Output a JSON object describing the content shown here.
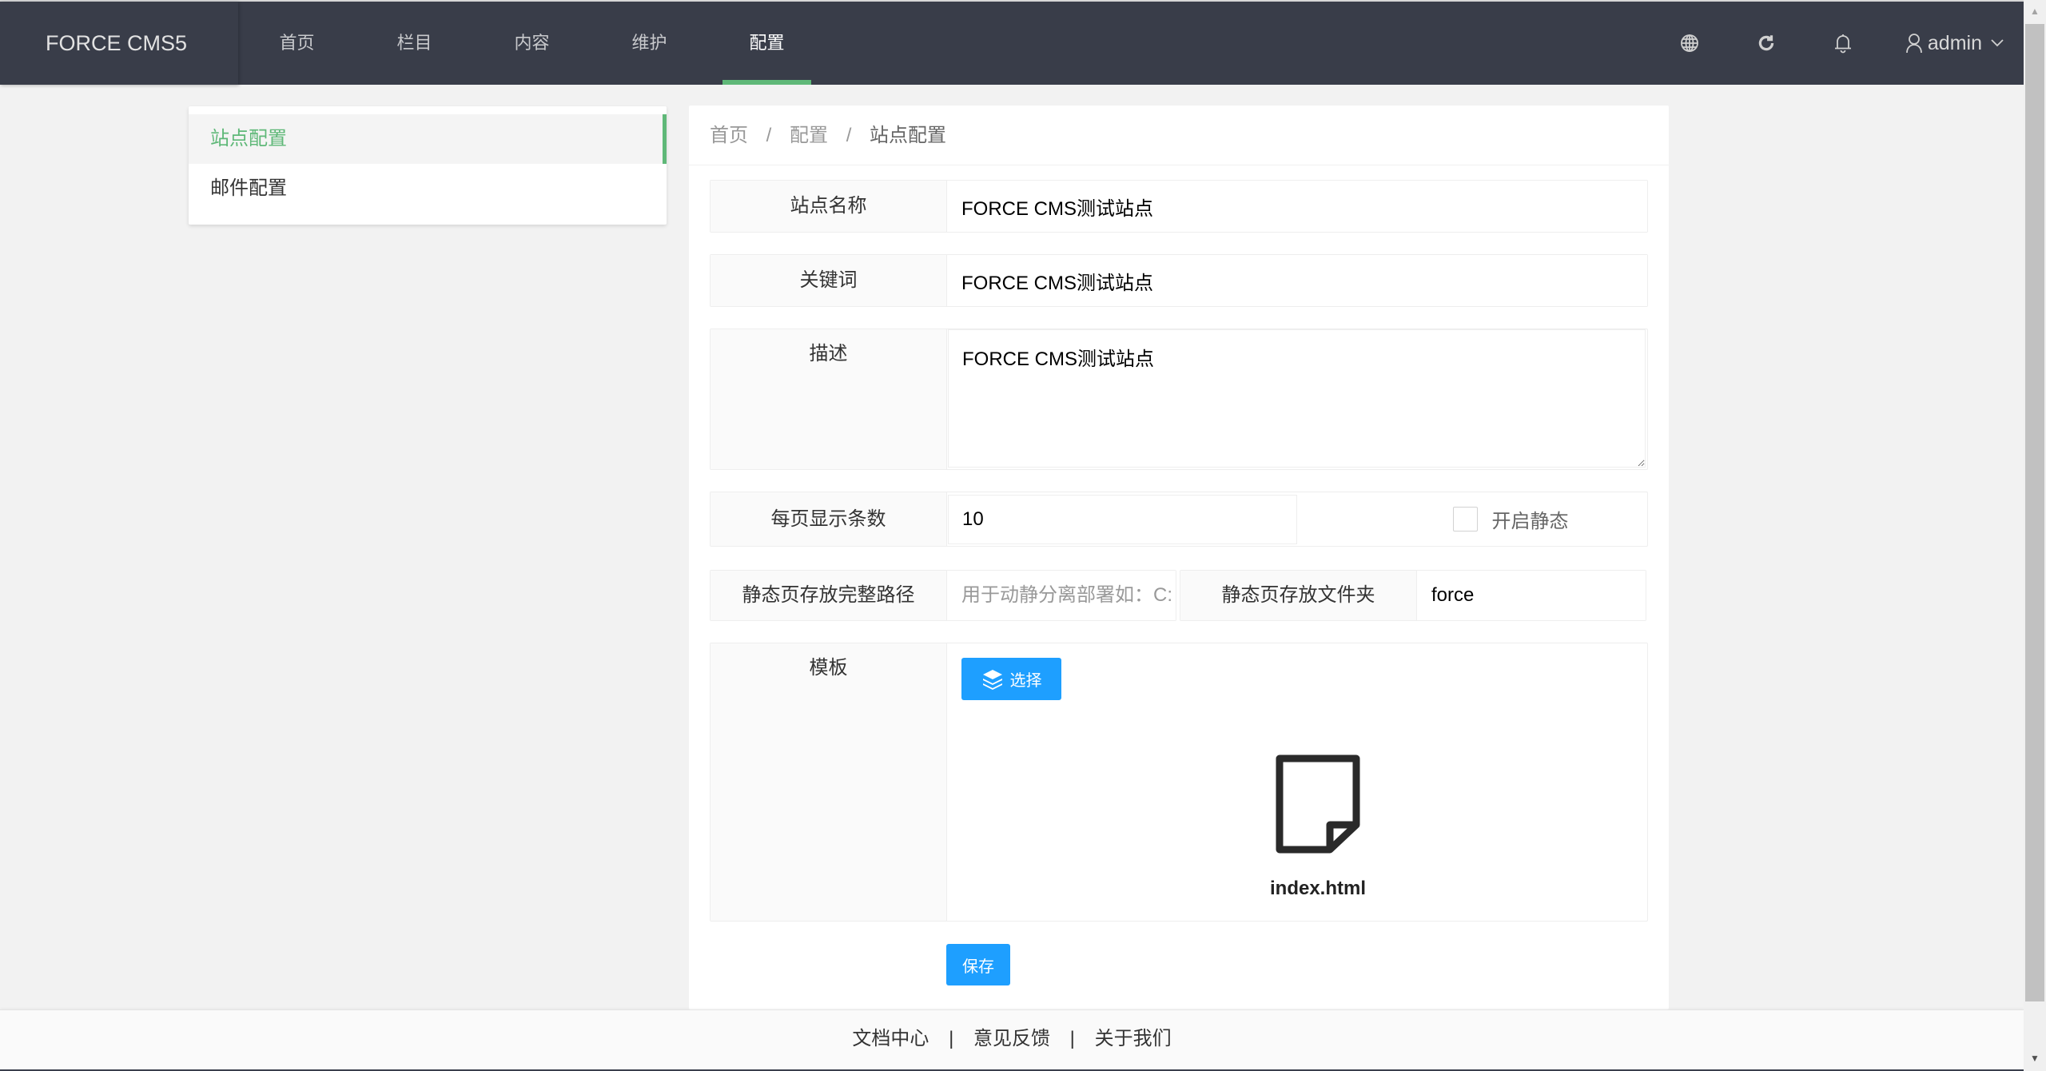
{
  "header": {
    "logo": "FORCE CMS5",
    "nav": [
      {
        "label": "首页",
        "active": false
      },
      {
        "label": "栏目",
        "active": false
      },
      {
        "label": "内容",
        "active": false
      },
      {
        "label": "维护",
        "active": false
      },
      {
        "label": "配置",
        "active": true
      }
    ],
    "icons": [
      "globe-icon",
      "refresh-icon",
      "bell-icon"
    ],
    "user": {
      "name": "admin",
      "icon": "user-icon",
      "dropdown_icon": "chevron-down-icon"
    }
  },
  "sidebar": {
    "items": [
      {
        "label": "站点配置",
        "active": true
      },
      {
        "label": "邮件配置",
        "active": false
      }
    ]
  },
  "breadcrumb": [
    "首页",
    "配置",
    "站点配置"
  ],
  "breadcrumb_separator": "/",
  "form": {
    "site_name": {
      "label": "站点名称",
      "value": "FORCE CMS测试站点"
    },
    "keywords": {
      "label": "关键词",
      "value": "FORCE CMS测试站点"
    },
    "description": {
      "label": "描述",
      "value": "FORCE CMS测试站点"
    },
    "page_size": {
      "label": "每页显示条数",
      "value": "10"
    },
    "enable_static": {
      "label": "开启静态",
      "checked": false
    },
    "static_path": {
      "label": "静态页存放完整路径",
      "value": "",
      "placeholder": "用于动静分离部署如：C:"
    },
    "static_folder": {
      "label": "静态页存放文件夹",
      "value": "force"
    },
    "template": {
      "label": "模板",
      "select_button": "选择",
      "file_name": "index.html"
    },
    "save_button": "保存"
  },
  "footer": {
    "links": [
      "文档中心",
      "意见反馈",
      "关于我们"
    ],
    "separator": "|"
  },
  "colors": {
    "header_bg": "#393D49",
    "accent_green": "#5FB878",
    "primary_blue": "#1E9FFF"
  }
}
